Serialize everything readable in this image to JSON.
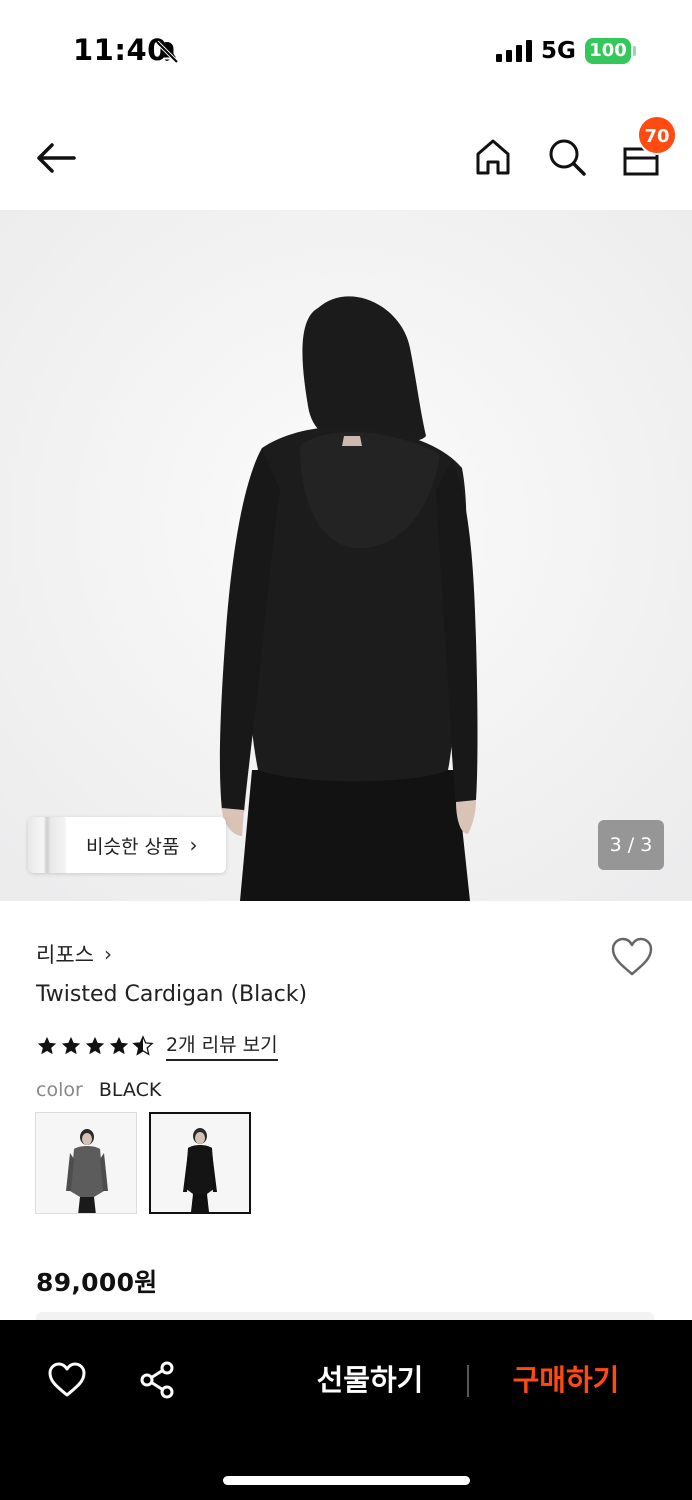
{
  "status_bar": {
    "time": "11:40",
    "network": "5G",
    "battery": "100"
  },
  "nav": {
    "cart_count": "70",
    "icons": [
      "back-arrow-icon",
      "home-icon",
      "search-icon",
      "shopping-bag-icon"
    ]
  },
  "hero": {
    "similar_label": "비슷한 상품",
    "similar_chevron": "›",
    "pager": "3 / 3"
  },
  "product": {
    "brand": "리포스",
    "brand_chevron": "›",
    "title": "Twisted Cardigan (Black)",
    "rating": 4.5,
    "review_link": "2개 리뷰 보기",
    "color_key": "color",
    "color_value": "BLACK",
    "swatches": [
      {
        "name": "charcoal",
        "selected": false
      },
      {
        "name": "black",
        "selected": true
      }
    ],
    "price": "89,000원"
  },
  "bottom_bar": {
    "gift_label": "선물하기",
    "buy_label": "구매하기",
    "buy_color": "#ff4a12"
  },
  "colors": {
    "accent": "#ff4a12",
    "battery": "#34c759"
  }
}
